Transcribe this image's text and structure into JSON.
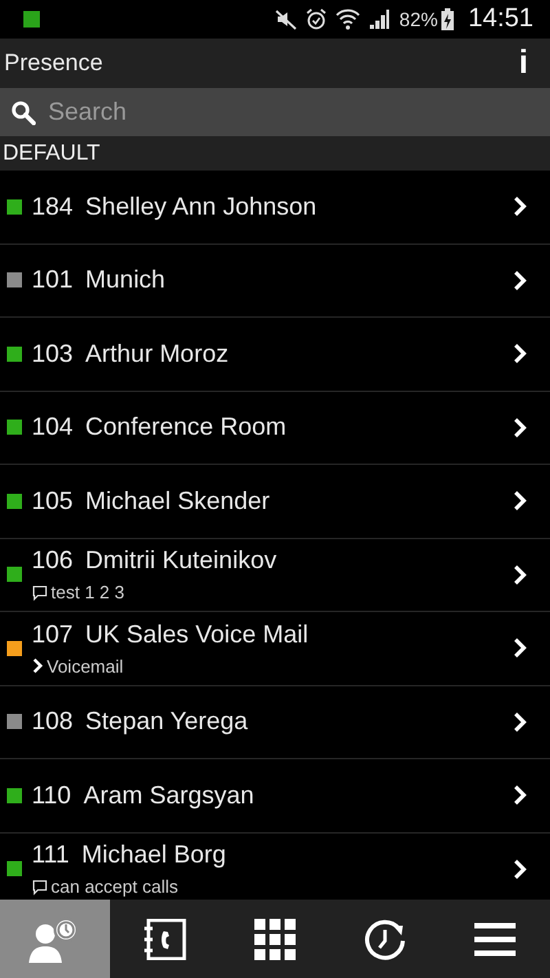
{
  "status_bar": {
    "battery": "82%",
    "time": "14:51"
  },
  "app_bar": {
    "title": "Presence",
    "info": "i"
  },
  "search": {
    "placeholder": "Search"
  },
  "section": {
    "title": "DEFAULT"
  },
  "contacts": [
    {
      "ext": "184",
      "name": "Shelley Ann Johnson",
      "color": "#2fae1b"
    },
    {
      "ext": "101",
      "name": "Munich",
      "color": "#8a8a8a"
    },
    {
      "ext": "103",
      "name": "Arthur Moroz",
      "color": "#2fae1b"
    },
    {
      "ext": "104",
      "name": "Conference Room",
      "color": "#2fae1b"
    },
    {
      "ext": "105",
      "name": "Michael Skender",
      "color": "#2fae1b"
    },
    {
      "ext": "106",
      "name": "Dmitrii Kuteinikov",
      "color": "#2fae1b",
      "sub": {
        "kind": "note",
        "text": "test 1 2 3"
      }
    },
    {
      "ext": "107",
      "name": "UK Sales Voice Mail",
      "color": "#f59e1c",
      "sub": {
        "kind": "forward",
        "text": "Voicemail"
      }
    },
    {
      "ext": "108",
      "name": "Stepan Yerega",
      "color": "#8a8a8a"
    },
    {
      "ext": "110",
      "name": "Aram Sargsyan",
      "color": "#2fae1b"
    },
    {
      "ext": "111",
      "name": "Michael Borg",
      "color": "#2fae1b",
      "sub": {
        "kind": "note",
        "text": "can accept calls"
      }
    }
  ],
  "nav": [
    {
      "kind": "presence",
      "selected": true
    },
    {
      "kind": "contacts",
      "selected": false
    },
    {
      "kind": "dialpad",
      "selected": false
    },
    {
      "kind": "history",
      "selected": false
    },
    {
      "kind": "menu",
      "selected": false
    }
  ]
}
